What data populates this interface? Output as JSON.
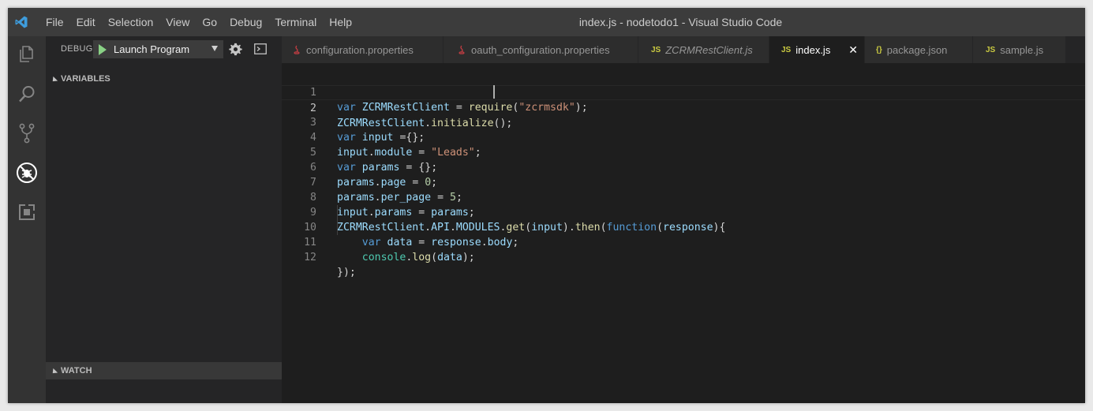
{
  "titlebar": {
    "menu": [
      "File",
      "Edit",
      "Selection",
      "View",
      "Go",
      "Debug",
      "Terminal",
      "Help"
    ],
    "title": "index.js - nodetodo1 - Visual Studio Code"
  },
  "activitybar": {
    "icons": [
      "explorer-icon",
      "search-icon",
      "source-control-icon",
      "debug-icon",
      "extensions-icon"
    ],
    "active": "debug-icon"
  },
  "debug": {
    "label": "DEBUG",
    "launch_config": "Launch Program",
    "run_color": "#89d185"
  },
  "sidebar": {
    "variables_label": "VARIABLES",
    "watch_label": "WATCH"
  },
  "tabs": [
    {
      "label": "configuration.properties",
      "icon": "java-icon",
      "active": false
    },
    {
      "label": "oauth_configuration.properties",
      "icon": "java-icon",
      "active": false
    },
    {
      "label": "ZCRMRestClient.js",
      "icon": "js-icon",
      "icon_text": "JS",
      "active": false,
      "italic": true
    },
    {
      "label": "index.js",
      "icon": "js-icon",
      "icon_text": "JS",
      "active": true
    },
    {
      "label": "package.json",
      "icon": "json-icon",
      "icon_text": "{}",
      "active": false
    },
    {
      "label": "sample.js",
      "icon": "js-icon",
      "icon_text": "JS",
      "active": false
    }
  ],
  "editor": {
    "current_line": 2,
    "lines": [
      {
        "n": "1",
        "text": "var ZCRMRestClient = require(\"zcrmsdk\");"
      },
      {
        "n": "2",
        "text": "ZCRMRestClient.initialize();"
      },
      {
        "n": "3",
        "text": "var input ={};"
      },
      {
        "n": "4",
        "text": "input.module = \"Leads\";"
      },
      {
        "n": "5",
        "text": "var params = {};"
      },
      {
        "n": "6",
        "text": "params.page = 0;"
      },
      {
        "n": "7",
        "text": "params.per_page = 5;"
      },
      {
        "n": "8",
        "text": "input.params = params;"
      },
      {
        "n": "9",
        "text": "ZCRMRestClient.API.MODULES.get(input).then(function(response){"
      },
      {
        "n": "10",
        "text": "    var data = response.body;"
      },
      {
        "n": "11",
        "text": "    console.log(data);"
      },
      {
        "n": "12",
        "text": "});"
      }
    ]
  },
  "colors": {
    "keyword": "#569cd6",
    "identifier": "#9cdcfe",
    "function": "#dcdcaa",
    "string": "#ce9178",
    "number": "#b5cea8",
    "accent": "#007acc"
  }
}
